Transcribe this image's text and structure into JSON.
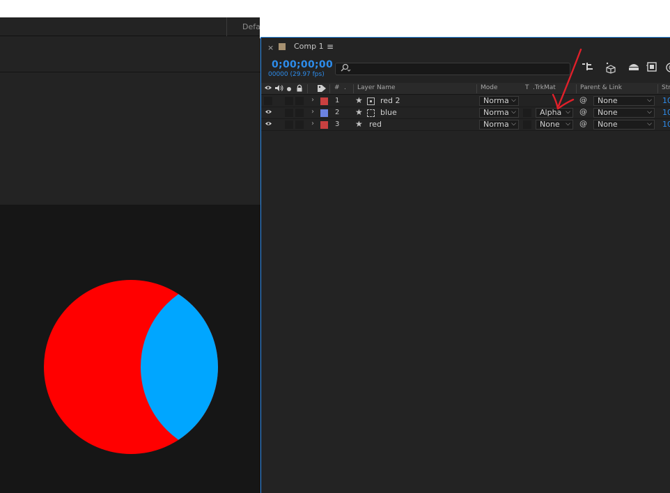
{
  "workspace": {
    "label": "Defa"
  },
  "timeline": {
    "tab": {
      "close": "×",
      "title": "Comp 1",
      "menu": "≡"
    },
    "timecode": "0;00;00;00",
    "fps": "00000 (29.97 fps)",
    "search": {
      "icon": "search-icon",
      "placeholder": ""
    },
    "headers": {
      "num": "#",
      "dot": ".",
      "layer_name": "Layer Name",
      "mode": "Mode",
      "t": "T",
      "trkmat": ".TrkMat",
      "parent": "Parent & Link",
      "stretch": "Str"
    },
    "layers": [
      {
        "num": "1",
        "name": "red 2",
        "label_color": "#c94040",
        "eye": "",
        "mode": "Norma",
        "trkmat": "",
        "parent": "None",
        "stretch": "10"
      },
      {
        "num": "2",
        "name": "blue",
        "label_color": "#6b82e0",
        "eye": "👁",
        "mode": "Norma",
        "trkmat": "Alpha",
        "parent": "None",
        "stretch": "10"
      },
      {
        "num": "3",
        "name": "red",
        "label_color": "#c94040",
        "eye": "👁",
        "mode": "Norma",
        "trkmat": "None",
        "parent": "None",
        "stretch": "10"
      }
    ]
  },
  "viewer": {
    "red_color": "#ff0000",
    "blue_color": "#00a6ff",
    "background": "#161616"
  },
  "colors": {
    "accent": "#2d8ceb",
    "annotation": "#e0202a"
  }
}
